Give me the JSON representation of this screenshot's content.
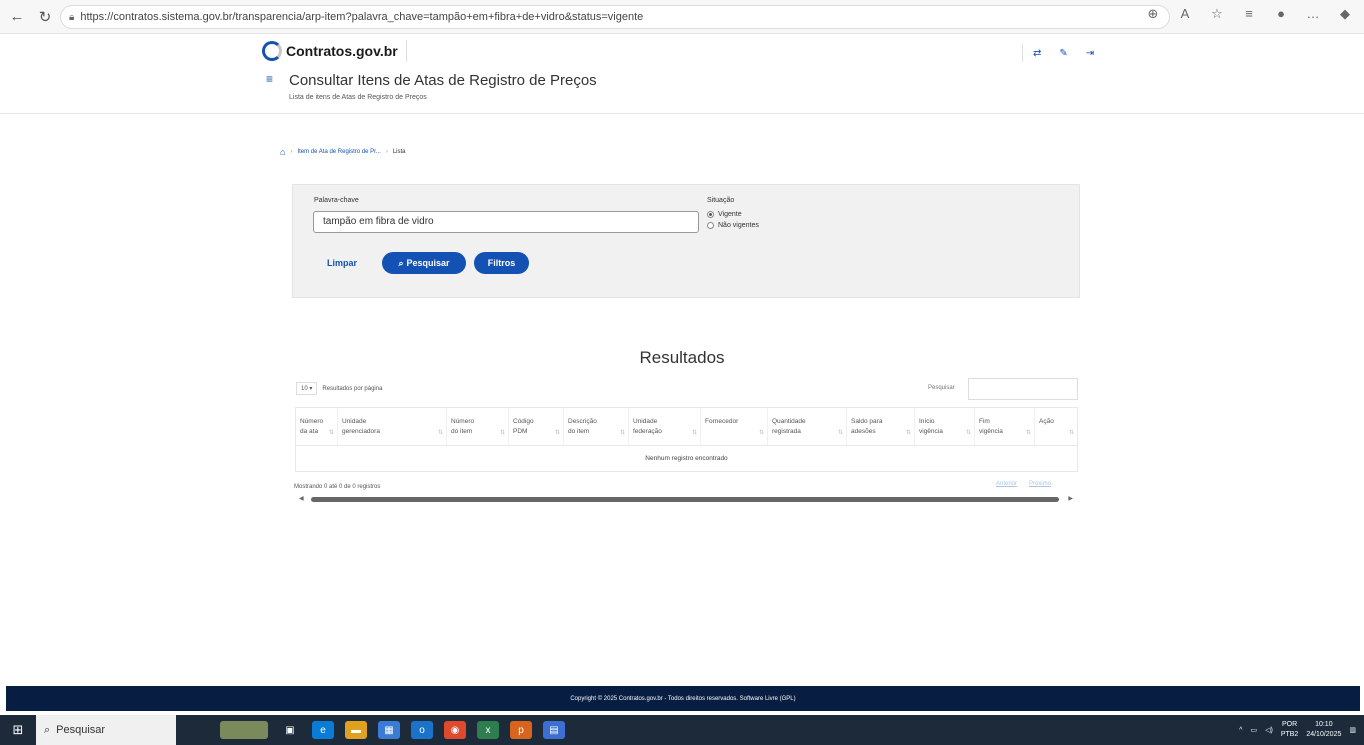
{
  "browser": {
    "url": "https://contratos.sistema.gov.br/transparencia/arp-item?palavra_chave=tampão+em+fibra+de+vidro&status=vigente"
  },
  "header": {
    "logo_text": "Contratos.gov.br",
    "title": "Consultar Itens de Atas de Registro de Preços",
    "subtitle": "Lista de itens de Atas de Registro de Preços"
  },
  "breadcrumb": {
    "item1": "Item de Ata de Registro de Pr...",
    "item2": "Lista"
  },
  "search": {
    "keyword_label": "Palavra-chave",
    "keyword_value": "tampão em fibra de vidro",
    "situation_label": "Situação",
    "option_active": "Vigente",
    "option_inactive": "Não vigentes",
    "clear_label": "Limpar",
    "search_label": "Pesquisar",
    "filters_label": "Filtros"
  },
  "results": {
    "title": "Resultados",
    "per_page_value": "10",
    "per_page_label": "Resultados por página",
    "search_label": "Pesquisar",
    "columns": [
      {
        "line1": "Número",
        "line2": "da ata"
      },
      {
        "line1": "Unidade",
        "line2": "gerenciadora"
      },
      {
        "line1": "Número",
        "line2": "do item"
      },
      {
        "line1": "Código",
        "line2": "PDM"
      },
      {
        "line1": "Descrição",
        "line2": "do item"
      },
      {
        "line1": "Unidade",
        "line2": "federação"
      },
      {
        "line1": "",
        "line2": "Fornecedor"
      },
      {
        "line1": "Quantidade",
        "line2": "registrada"
      },
      {
        "line1": "Saldo para",
        "line2": "adesões"
      },
      {
        "line1": "Início",
        "line2": "vigência"
      },
      {
        "line1": "Fim",
        "line2": "vigência"
      },
      {
        "line1": "",
        "line2": "Ação"
      }
    ],
    "no_records": "Nenhum registro encontrado",
    "showing": "Mostrando 0 até 0 de 0 registros",
    "prev_label": "Anterior",
    "next_label": "Próximo"
  },
  "footer": {
    "text": "Copyright © 2025 Contratos.gov.br - Todos direitos reservados. Software Livre (GPL)"
  },
  "taskbar": {
    "search_placeholder": "Pesquisar",
    "lang1": "POR",
    "lang2": "PTB2",
    "time": "10:10",
    "date": "24/10/2025"
  }
}
